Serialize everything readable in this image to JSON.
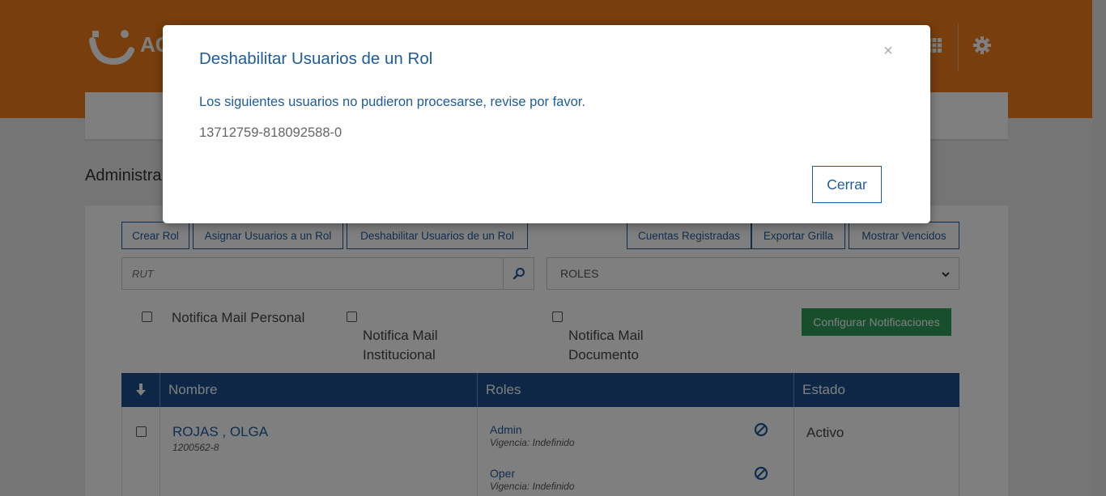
{
  "header": {
    "logo_text": "AC",
    "brand_color": "#f07d1a",
    "icons": [
      "grid-icon",
      "gear-icon"
    ]
  },
  "page": {
    "title": "Administra"
  },
  "toolbar": {
    "crear_rol": "Crear Rol",
    "asignar_usuarios": "Asignar Usuarios a un Rol",
    "deshabilitar_usuarios": "Deshabilitar Usuarios de un Rol",
    "cuentas_registradas": "Cuentas Registradas",
    "exportar_grilla": "Exportar Grilla",
    "mostrar_vencidos": "Mostrar Vencidos"
  },
  "filters": {
    "rut_placeholder": "RUT",
    "roles_selected": "ROLES"
  },
  "notifications": {
    "mail_personal": "Notifica Mail Personal",
    "mail_institucional": [
      "Notifica Mail",
      "Institucional"
    ],
    "mail_documento": [
      "Notifica Mail",
      "Documento"
    ],
    "configurar": "Configurar Notificaciones"
  },
  "table": {
    "headers": {
      "nombre": "Nombre",
      "roles": "Roles",
      "estado": "Estado"
    },
    "rows": [
      {
        "nombre": "ROJAS , OLGA",
        "rut": "1200562-8",
        "roles": [
          {
            "name": "Admin",
            "vigencia": "Vigencia: Indefinido"
          },
          {
            "name": "Oper",
            "vigencia": "Vigencia: Indefinido"
          }
        ],
        "estado": "Activo"
      }
    ]
  },
  "modal": {
    "title": "Deshabilitar Usuarios de un Rol",
    "close": "×",
    "message": "Los siguientes usuarios no pudieron procesarse, revise por favor.",
    "failed_user": "13712759-818092588-0",
    "button": "Cerrar"
  }
}
